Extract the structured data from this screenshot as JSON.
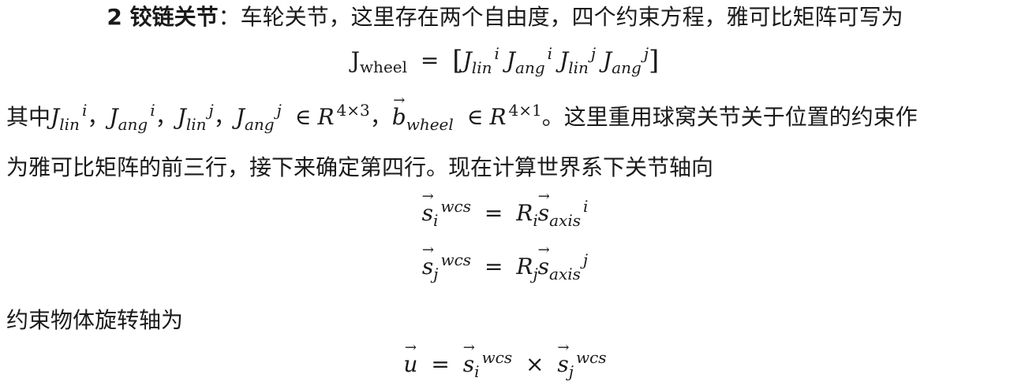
{
  "line1": {
    "heading": "2 铰链关节",
    "rest": "：车轮关节，这里存在两个自由度，四个约束方程，雅可比矩阵可写为"
  },
  "eq_jwheel": {
    "lhs": "J",
    "lhs_sub": "wheel",
    "eq": "=",
    "open": "[",
    "close": "]",
    "t1": "J",
    "t1_sub": "lin",
    "t1_sup": "i",
    "t2": "J",
    "t2_sub": "ang",
    "t2_sup": "i",
    "t3": "J",
    "t3_sub": "lin",
    "t3_sup": "j",
    "t4": "J",
    "t4_sub": "ang",
    "t4_sup": "j"
  },
  "para1": {
    "prefix": "其中",
    "a": "J",
    "a_sub": "lin",
    "a_sup": "i",
    "sep1": "，",
    "b": "J",
    "b_sub": "ang",
    "b_sup": "i",
    "sep2": "，",
    "c": "J",
    "c_sub": "lin",
    "c_sup": "j",
    "sep3": "，",
    "d": "J",
    "d_sub": "ang",
    "d_sup": "j",
    "in1": "∈",
    "R1": "R",
    "R1_sup": "4×3",
    "sep4": "，",
    "vec_b": "b",
    "vec_b_sub": "wheel",
    "in2": "∈",
    "R2": "R",
    "R2_sup": "4×1",
    "suffix": "。这里重用球窝关节关于位置的约束作"
  },
  "para2": "为雅可比矩阵的前三行，接下来确定第四行。现在计算世界系下关节轴向",
  "eq_si": {
    "s": "s",
    "sub": "i",
    "sup": "wcs",
    "eq": "=",
    "R": "R",
    "R_sub": "i",
    "s2": "s",
    "s2_sub": "axis",
    "s2_sup": "i"
  },
  "eq_sj": {
    "s": "s",
    "sub": "j",
    "sup": "wcs",
    "eq": "=",
    "R": "R",
    "R_sub": "j",
    "s2": "s",
    "s2_sub": "axis",
    "s2_sup": "j"
  },
  "para3": "约束物体旋转轴为",
  "eq_u": {
    "u": "u",
    "eq": "=",
    "s1": "s",
    "s1_sub": "i",
    "s1_sup": "wcs",
    "times": "×",
    "s2": "s",
    "s2_sub": "j",
    "s2_sup": "wcs"
  }
}
